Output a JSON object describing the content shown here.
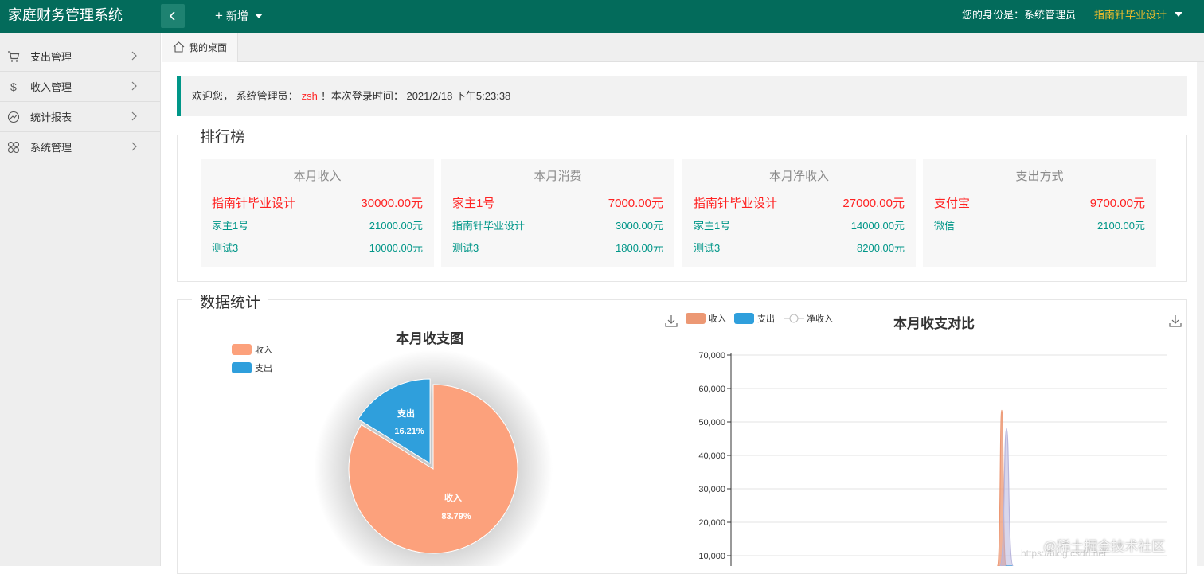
{
  "app": {
    "title": "家庭财务管理系统",
    "new_label": "新增",
    "role_label": "您的身份是：系统管理员",
    "user_name": "指南针毕业设计"
  },
  "colors": {
    "topbar": "#036b5b",
    "accent": "#009688",
    "highlight": "#ff2626",
    "user": "#f6c02a"
  },
  "sidebar": {
    "items": [
      {
        "label": "支出管理",
        "icon": "cart-icon"
      },
      {
        "label": "收入管理",
        "icon": "dollar-icon"
      },
      {
        "label": "统计报表",
        "icon": "chart-icon"
      },
      {
        "label": "系统管理",
        "icon": "grid-icon"
      }
    ]
  },
  "tabs": {
    "home": "我的桌面"
  },
  "welcome": {
    "prefix": "欢迎您，  系统管理员：",
    "name": "zsh",
    "suffix": "！本次登录时间：  2021/2/18 下午5:23:38"
  },
  "ranking": {
    "legend": "排行榜",
    "cards": [
      {
        "title": "本月收入",
        "rows": [
          {
            "name": "指南针毕业设计",
            "value": "30000.00元"
          },
          {
            "name": "家主1号",
            "value": "21000.00元"
          },
          {
            "name": "测试3",
            "value": "10000.00元"
          }
        ]
      },
      {
        "title": "本月消费",
        "rows": [
          {
            "name": "家主1号",
            "value": "7000.00元"
          },
          {
            "name": "指南针毕业设计",
            "value": "3000.00元"
          },
          {
            "name": "测试3",
            "value": "1800.00元"
          }
        ]
      },
      {
        "title": "本月净收入",
        "rows": [
          {
            "name": "指南针毕业设计",
            "value": "27000.00元"
          },
          {
            "name": "家主1号",
            "value": "14000.00元"
          },
          {
            "name": "测试3",
            "value": "8200.00元"
          }
        ]
      },
      {
        "title": "支出方式",
        "rows": [
          {
            "name": "支付宝",
            "value": "9700.00元"
          },
          {
            "name": "微信",
            "value": "2100.00元"
          }
        ]
      }
    ]
  },
  "stats": {
    "legend": "数据统计"
  },
  "chart_data": [
    {
      "type": "pie",
      "title": "本月收支图",
      "legend": [
        "收入",
        "支出"
      ],
      "legend_position": "top-left",
      "slices": [
        {
          "name": "收入",
          "percent": 83.79,
          "label": "83.79%",
          "color": "#fca17c"
        },
        {
          "name": "支出",
          "percent": 16.21,
          "label": "16.21%",
          "color": "#2f9fdc"
        }
      ]
    },
    {
      "type": "area",
      "title": "本月收支对比",
      "legend": [
        "收入",
        "支出",
        "净收入"
      ],
      "legend_position": "top-left",
      "colors": {
        "收入": "#ec9874",
        "支出": "#2f9fdc",
        "净收入": "#b8b5dc"
      },
      "ylim": [
        0,
        70000
      ],
      "yticks": [
        "10,000",
        "20,000",
        "30,000",
        "40,000",
        "50,000",
        "60,000",
        "70,000"
      ],
      "grid": true,
      "series": [
        {
          "name": "收入",
          "peak": 53500
        },
        {
          "name": "净收入",
          "peak": 48000
        },
        {
          "name": "支出",
          "peak": 3000
        }
      ]
    }
  ],
  "watermark": "@稀土掘金技术社区"
}
